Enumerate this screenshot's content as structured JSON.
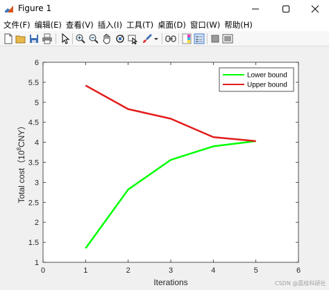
{
  "window": {
    "title": "Figure 1"
  },
  "menu": [
    "文件(F)",
    "编辑(E)",
    "查看(V)",
    "插入(I)",
    "工具(T)",
    "桌面(D)",
    "窗口(W)",
    "帮助(H)"
  ],
  "toolbar": {
    "icons": [
      "new-figure-icon",
      "open-file-icon",
      "save-icon",
      "print-icon",
      "edit-plot-arrow-icon",
      "zoom-in-icon",
      "zoom-out-icon",
      "pan-hand-icon",
      "rotate-3d-icon",
      "data-cursor-icon",
      "brush-icon",
      "brush-dropdown-icon",
      "link-plot-icon",
      "insert-colorbar-icon",
      "insert-legend-icon",
      "hide-plot-tools-icon",
      "show-plot-tools-icon"
    ]
  },
  "colors": {
    "lower": "#00ff00",
    "upper": "#e31b1b",
    "plot_bg": "#ffffff",
    "figure_bg": "#f0f0f0"
  },
  "chart_data": {
    "type": "line",
    "xlabel": "Iterations",
    "ylabel_prefix": "Total cost（10",
    "ylabel_sup": "8",
    "ylabel_suffix": "CNY）",
    "xlim": [
      0,
      6
    ],
    "ylim": [
      1,
      6
    ],
    "xticks": [
      "0",
      "1",
      "2",
      "3",
      "4",
      "5",
      "6"
    ],
    "yticks": [
      "1",
      "1.5",
      "2",
      "2.5",
      "3",
      "3.5",
      "4",
      "4.5",
      "5",
      "5.5",
      "6"
    ],
    "x": [
      1,
      2,
      3,
      4,
      5
    ],
    "series": [
      {
        "name": "Lower bound",
        "values": [
          1.35,
          2.82,
          3.56,
          3.9,
          4.03
        ]
      },
      {
        "name": "Upper bound",
        "values": [
          5.42,
          4.83,
          4.59,
          4.13,
          4.03
        ]
      }
    ],
    "legend": "top-right",
    "grid": false
  },
  "watermark": "CSDN @荔枝科研社"
}
